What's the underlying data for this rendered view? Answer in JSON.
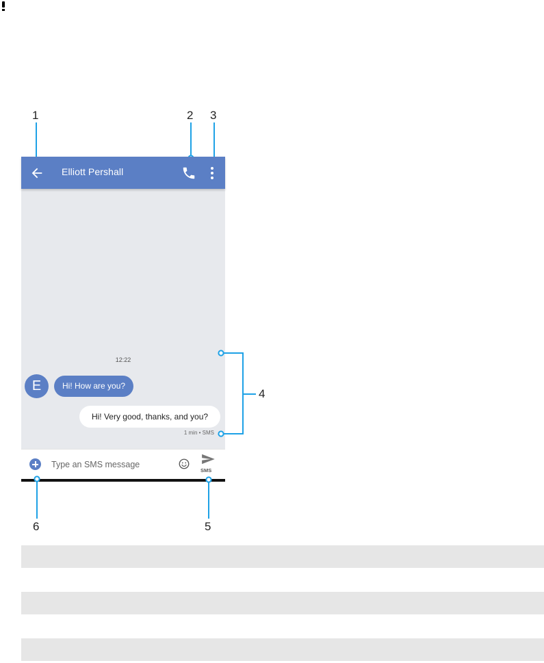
{
  "contact_name": "Elliott Pershall",
  "thread": {
    "timestamp": "12:22",
    "avatar_letter": "E",
    "incoming_message": "Hi! How are you?",
    "outgoing_message": "Hi! Very good, thanks, and you?",
    "outgoing_meta": "1 min • SMS"
  },
  "composer": {
    "placeholder": "Type an SMS message",
    "send_label": "SMS"
  },
  "callouts": [
    "1",
    "2",
    "3",
    "4",
    "5",
    "6"
  ],
  "table_rows": [
    "",
    "",
    "",
    "",
    ""
  ],
  "colors": {
    "accent": "#5b7fc5",
    "callout": "#1da1e6",
    "thread_bg": "#e7e9ed"
  },
  "icons": [
    "alert-icon",
    "back-arrow-icon",
    "phone-icon",
    "more-vert-icon",
    "add-circle-icon",
    "emoji-icon",
    "send-icon"
  ]
}
